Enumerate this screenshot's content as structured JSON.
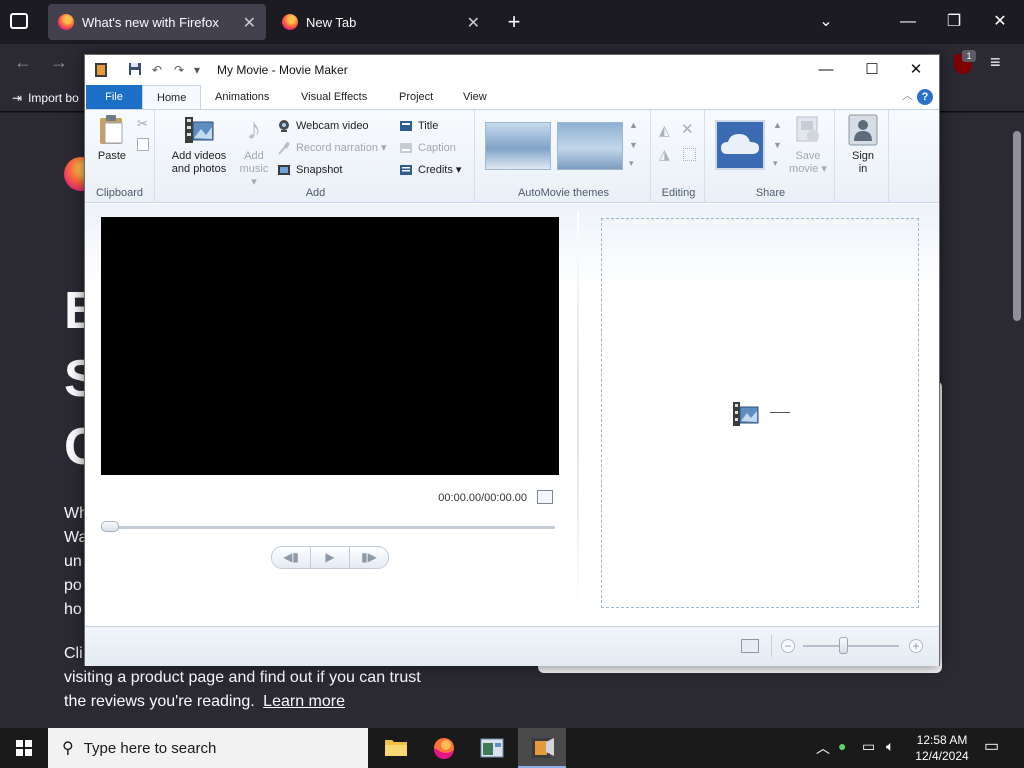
{
  "firefox": {
    "tabs": [
      {
        "label": "What's new with Firefox",
        "active": true
      },
      {
        "label": "New Tab",
        "active": false
      }
    ],
    "bookmark_label": "Import bo",
    "notification_count": "1",
    "content": {
      "big_letters": [
        "B",
        "S",
        "C"
      ],
      "side_lines": [
        "Wh",
        "Wa",
        "un",
        "po",
        "ho"
      ],
      "cli_prefix": "Cli",
      "para_line1": "visiting a product page and find out if you can trust",
      "para_line2": "the reviews you're reading.",
      "learn_more": "Learn more"
    }
  },
  "movie_maker": {
    "title": "My Movie - Movie Maker",
    "tabs": [
      "File",
      "Home",
      "Animations",
      "Visual Effects",
      "Project",
      "View"
    ],
    "help": "?",
    "ribbon": {
      "clipboard": {
        "label": "Clipboard",
        "paste": "Paste"
      },
      "add": {
        "label": "Add",
        "add_videos_line1": "Add videos",
        "add_videos_line2": "and photos",
        "add_music_line1": "Add",
        "add_music_line2": "music",
        "webcam": "Webcam video",
        "narration": "Record narration",
        "snapshot": "Snapshot",
        "title": "Title",
        "caption": "Caption",
        "credits": "Credits"
      },
      "automovie": {
        "label": "AutoMovie themes"
      },
      "editing": {
        "label": "Editing"
      },
      "share": {
        "label": "Share",
        "save_movie_line1": "Save",
        "save_movie_line2": "movie",
        "sign_in_line1": "Sign",
        "sign_in_line2": "in"
      }
    },
    "preview": {
      "time": "00:00.00/00:00.00"
    }
  },
  "taskbar": {
    "search_placeholder": "Type here to search",
    "time": "12:58 AM",
    "date": "12/4/2024"
  },
  "colors": {
    "file_tab": "#1d6ec7",
    "firefox_bg": "#2b2a33",
    "accent_link": "#fbfbfe"
  }
}
